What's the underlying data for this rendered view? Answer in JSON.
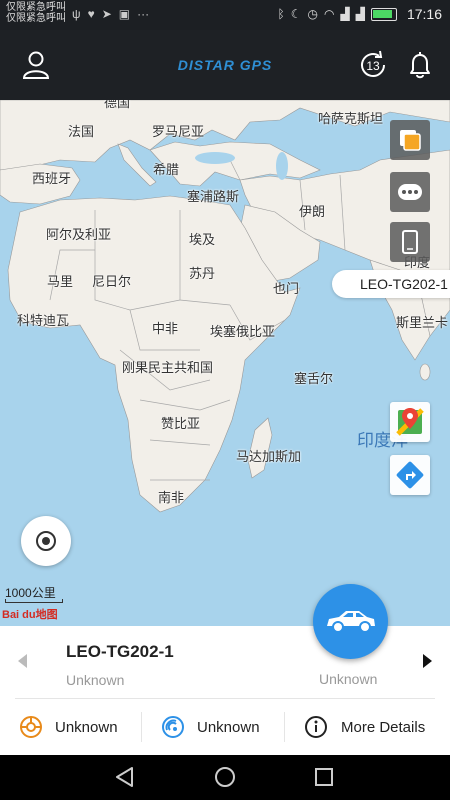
{
  "status_bar": {
    "carrier_line1": "仅限紧急呼叫",
    "carrier_line2": "仅限紧急呼叫",
    "battery_level": 0.9,
    "time": "17:16"
  },
  "header": {
    "title": "DISTAR GPS",
    "history_badge": "13"
  },
  "map": {
    "labels": {
      "germany": "德国",
      "france": "法国",
      "romania": "罗马尼亚",
      "kazakhstan": "哈萨克斯坦",
      "spain": "西班牙",
      "greece": "希腊",
      "cyprus": "塞浦路斯",
      "iran": "伊朗",
      "algeria": "阿尔及利亚",
      "egypt": "埃及",
      "india": "印度",
      "mali": "马里",
      "niger": "尼日尔",
      "sudan": "苏丹",
      "yemen": "也门",
      "ivory_coast": "科特迪瓦",
      "car": "中非",
      "ethiopia": "埃塞俄比亚",
      "sri_lanka": "斯里兰卡",
      "drc": "刚果民主共和国",
      "seychelles": "塞舌尔",
      "zambia": "赞比亚",
      "indian_ocean": "印度洋",
      "madagascar": "马达加斯加",
      "south_africa": "南非"
    },
    "vehicle_tag": "LEO-TG202-1",
    "scale": "1000公里",
    "brand": "Bai du地图"
  },
  "device": {
    "name": "LEO-TG202-1",
    "status": "Unknown",
    "status_right": "Unknown"
  },
  "actions": {
    "acc": "Unknown",
    "signal": "Unknown",
    "details": "More Details"
  },
  "colors": {
    "accent": "#2d91e7",
    "header_bg": "#1e2125",
    "ocean": "#a8d3ec",
    "land": "#f2efe9"
  }
}
